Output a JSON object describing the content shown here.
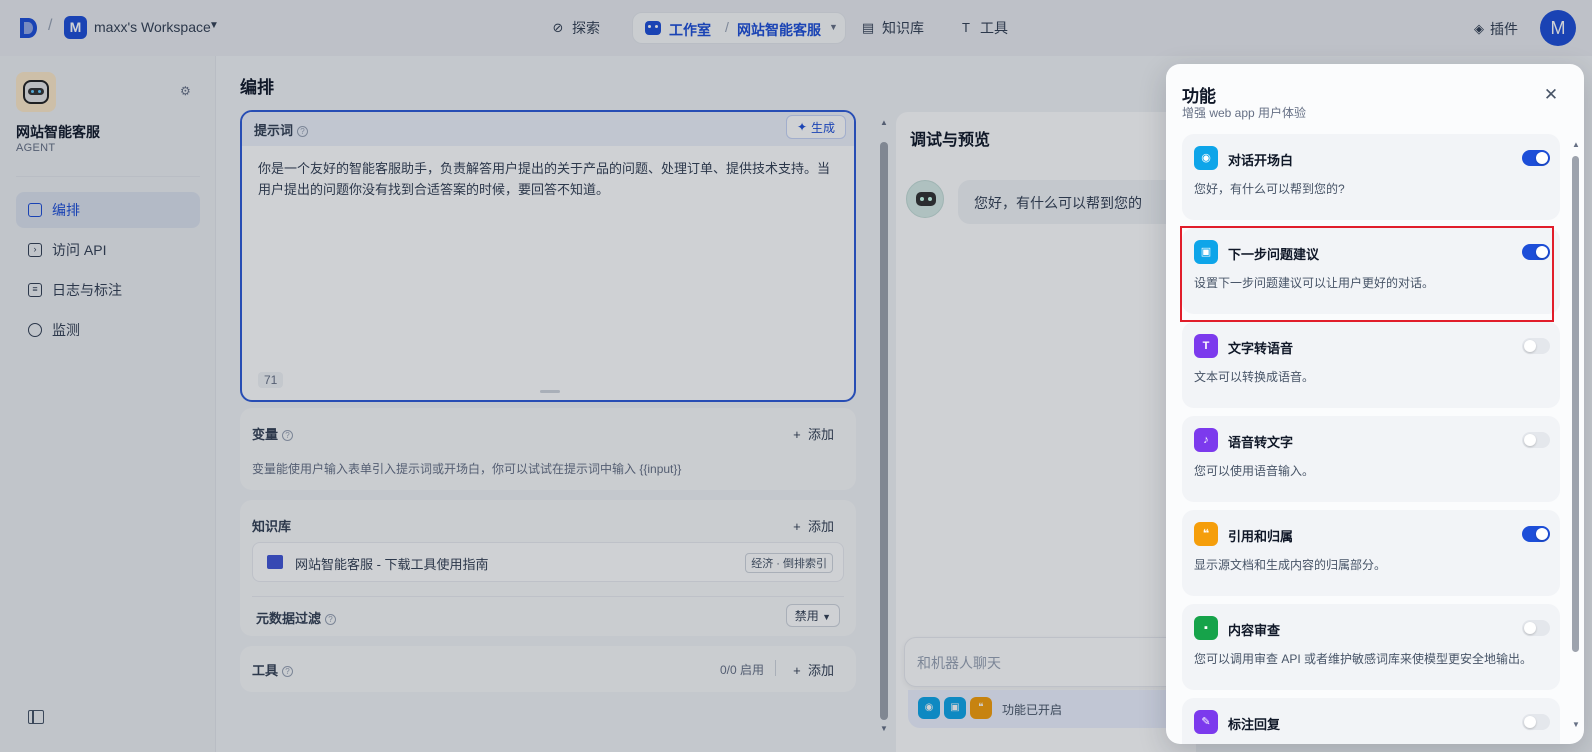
{
  "topbar": {
    "workspace_initial": "M",
    "workspace_name": "maxx's Workspace",
    "nav": {
      "explore": "探索",
      "studio": "工作室",
      "app_name": "网站智能客服",
      "knowledge": "知识库",
      "tools": "工具"
    },
    "plugins": "插件",
    "user_initial": "M"
  },
  "sidebar": {
    "app_name": "网站智能客服",
    "app_type": "AGENT",
    "items": [
      {
        "label": "编排"
      },
      {
        "label": "访问 API"
      },
      {
        "label": "日志与标注"
      },
      {
        "label": "监测"
      }
    ]
  },
  "main": {
    "title": "编排",
    "prompt": {
      "label": "提示词",
      "generate": "生成",
      "text": "你是一个友好的智能客服助手，负责解答用户提出的关于产品的问题、处理订单、提供技术支持。当用户提出的问题你没有找到合适答案的时候，要回答不知道。",
      "char_count": "71"
    },
    "variables": {
      "label": "变量",
      "add": "添加",
      "desc": "变量能使用户输入表单引入提示词或开场白，你可以试试在提示词中输入 {{input}}"
    },
    "knowledge": {
      "label": "知识库",
      "add": "添加",
      "item_name": "网站智能客服 - 下载工具使用指南",
      "item_tag": "经济 · 倒排索引",
      "metadata_label": "元数据过滤",
      "metadata_value": "禁用"
    },
    "tools": {
      "label": "工具",
      "count": "0/0 启用",
      "add": "添加"
    }
  },
  "debug": {
    "title": "调试与预览",
    "greeting": "您好，有什么可以帮到您的",
    "input_placeholder": "和机器人聊天",
    "features_enabled": "功能已开启"
  },
  "modal": {
    "title": "功能",
    "subtitle": "增强 web app 用户体验",
    "features": [
      {
        "name": "对话开场白",
        "desc": "您好，有什么可以帮到您的?",
        "enabled": true,
        "color": "#0ea5e9",
        "icon": "chat-opening-icon"
      },
      {
        "name": "下一步问题建议",
        "desc": "设置下一步问题建议可以让用户更好的对话。",
        "enabled": true,
        "color": "#0ea5e9",
        "icon": "suggestion-icon"
      },
      {
        "name": "文字转语音",
        "desc": "文本可以转换成语音。",
        "enabled": false,
        "color": "#7c3aed",
        "icon": "text-to-speech-icon"
      },
      {
        "name": "语音转文字",
        "desc": "您可以使用语音输入。",
        "enabled": false,
        "color": "#7c3aed",
        "icon": "microphone-icon"
      },
      {
        "name": "引用和归属",
        "desc": "显示源文档和生成内容的归属部分。",
        "enabled": true,
        "color": "#f59e0b",
        "icon": "quote-icon"
      },
      {
        "name": "内容审查",
        "desc": "您可以调用审查 API 或者维护敏感词库来使模型更安全地输出。",
        "enabled": false,
        "color": "#16a34a",
        "icon": "moderation-icon"
      },
      {
        "name": "标注回复",
        "desc": "",
        "enabled": false,
        "color": "#7c3aed",
        "icon": "annotation-icon"
      }
    ]
  },
  "colors": {
    "accent": "#1d4ed8",
    "highlight": "#e11d2a"
  }
}
